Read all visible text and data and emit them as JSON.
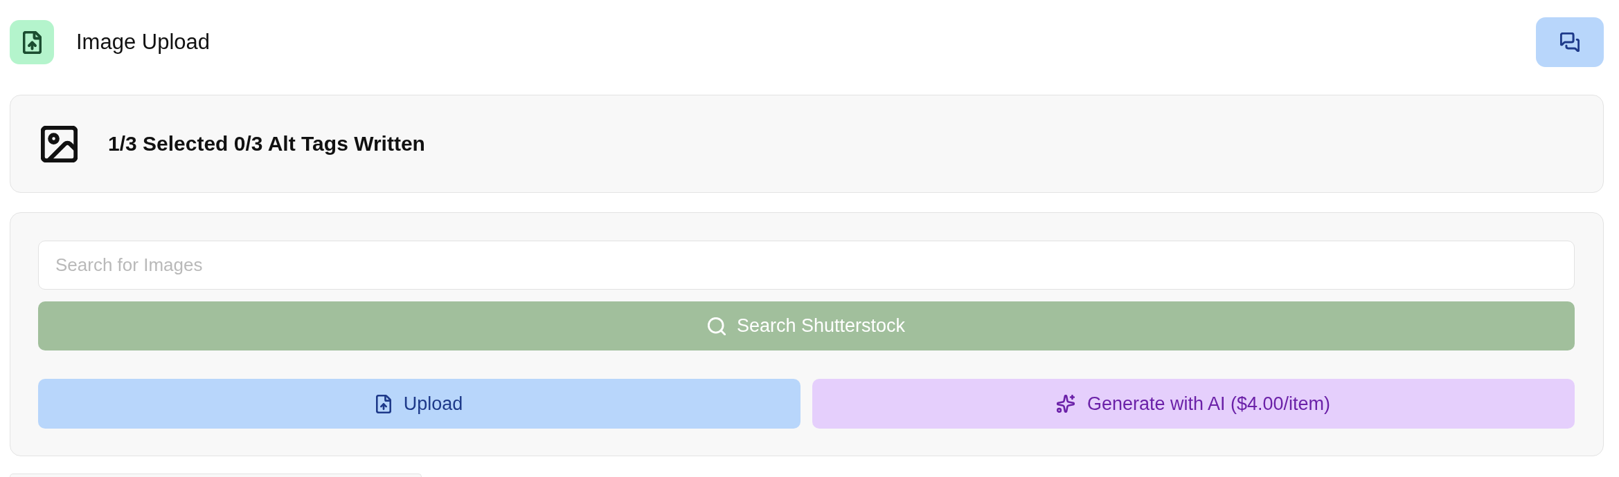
{
  "header": {
    "title": "Image Upload"
  },
  "summary": {
    "text": "1/3 Selected 0/3 Alt Tags Written"
  },
  "search": {
    "placeholder": "Search for Images",
    "button": {
      "label": "Search Shutterstock",
      "disabled": true
    }
  },
  "actions": [
    {
      "kind": "upload",
      "label": "Upload"
    },
    {
      "kind": "generate",
      "label": "Generate with AI ($4.00/item)"
    }
  ]
}
